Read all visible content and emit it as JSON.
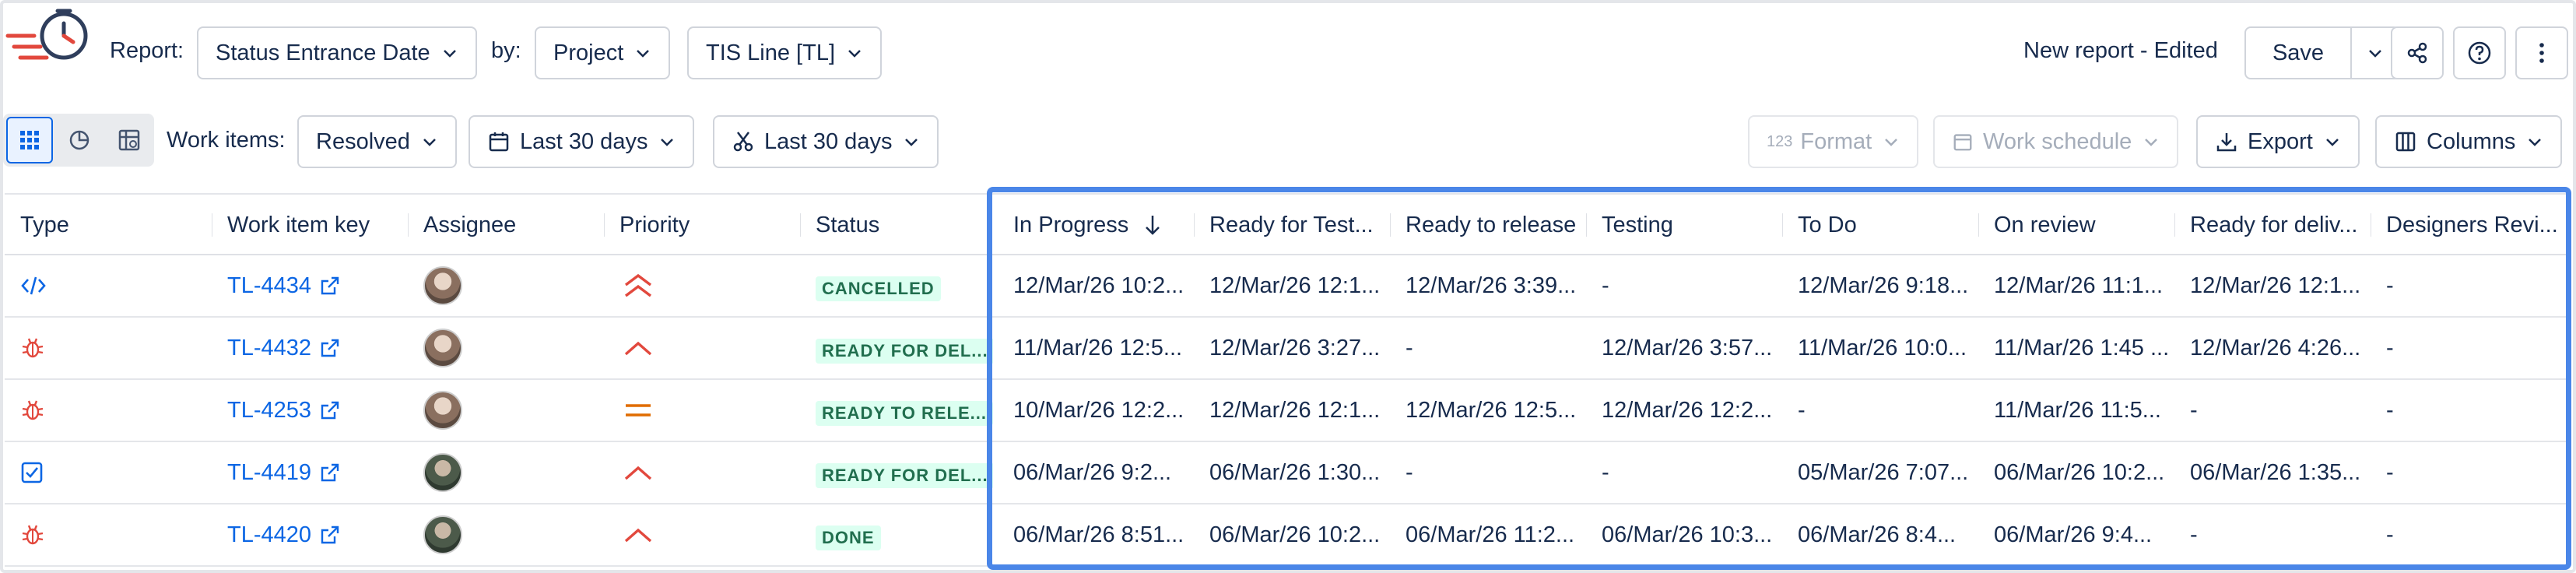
{
  "toolbar": {
    "report_label": "Report:",
    "report_value": "Status Entrance Date",
    "by_label": "by:",
    "by_value": "Project",
    "project_value": "TIS Line [TL]",
    "report_name": "New report - Edited",
    "save_label": "Save"
  },
  "filters": {
    "work_items_label": "Work items:",
    "work_items_value": "Resolved",
    "date_filter_1": "Last 30 days",
    "date_filter_2": "Last 30 days",
    "format_label": "Format",
    "format_prefix": "123",
    "work_schedule_label": "Work schedule",
    "export_label": "Export",
    "columns_label": "Columns"
  },
  "table": {
    "headers": [
      "Type",
      "Work item key",
      "Assignee",
      "Priority",
      "Status",
      "In Progress",
      "Ready for Test...",
      "Ready to release",
      "Testing",
      "To Do",
      "On review",
      "Ready for deliv...",
      "Designers Revi..."
    ],
    "rows": [
      {
        "type_icon": "code-icon",
        "key": "TL-4434",
        "priority_icon": "priority-highest-icon",
        "status": "CANCELLED",
        "dates": [
          "12/Mar/26 10:2...",
          "12/Mar/26 12:1...",
          "12/Mar/26 3:39...",
          "-",
          "12/Mar/26 9:18...",
          "12/Mar/26 11:1...",
          "12/Mar/26 12:1...",
          "-"
        ]
      },
      {
        "type_icon": "bug-icon",
        "key": "TL-4432",
        "priority_icon": "priority-high-icon",
        "status": "READY FOR DEL...",
        "dates": [
          "11/Mar/26 12:5...",
          "12/Mar/26 3:27...",
          "-",
          "12/Mar/26 3:57...",
          "11/Mar/26 10:0...",
          "11/Mar/26 1:45 ...",
          "12/Mar/26 4:26...",
          "-"
        ]
      },
      {
        "type_icon": "bug-icon",
        "key": "TL-4253",
        "priority_icon": "priority-medium-icon",
        "status": "READY TO RELE...",
        "dates": [
          "10/Mar/26 12:2...",
          "12/Mar/26 12:1...",
          "12/Mar/26 12:5...",
          "12/Mar/26 12:2...",
          "-",
          "11/Mar/26 11:5...",
          "-",
          "-"
        ]
      },
      {
        "type_icon": "task-icon",
        "key": "TL-4419",
        "priority_icon": "priority-high-icon",
        "status": "READY FOR DEL...",
        "dates": [
          "06/Mar/26 9:2...",
          "06/Mar/26 1:30...",
          "-",
          "-",
          "05/Mar/26 7:07...",
          "06/Mar/26 10:2...",
          "06/Mar/26 1:35...",
          "-"
        ]
      },
      {
        "type_icon": "bug-icon",
        "key": "TL-4420",
        "priority_icon": "priority-high-icon",
        "status": "DONE",
        "dates": [
          "06/Mar/26 8:51...",
          "06/Mar/26 10:2...",
          "06/Mar/26 11:2...",
          "06/Mar/26 10:3...",
          "06/Mar/26 8:4...",
          "06/Mar/26 9:4...",
          "-",
          "-"
        ]
      }
    ]
  },
  "colors": {
    "link": "#0c66e4",
    "highlight_border": "#4a86e8",
    "priority": "#e2483d",
    "priority_medium": "#e06c00",
    "bug": "#e2483d",
    "status_bg": "#dcfff1",
    "status_text": "#216e4e"
  }
}
